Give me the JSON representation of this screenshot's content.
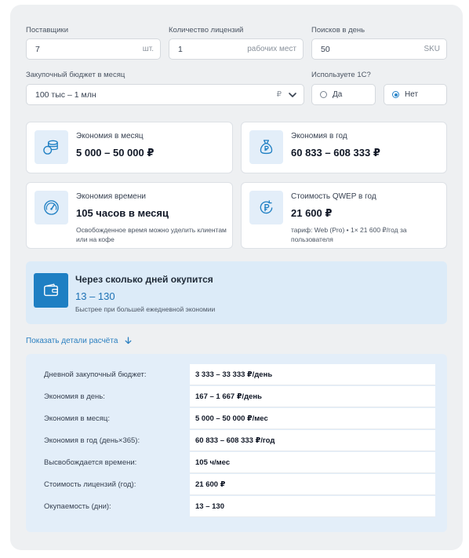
{
  "form": {
    "suppliers": {
      "label": "Поставщики",
      "value": "7",
      "unit": "шт."
    },
    "licenses": {
      "label": "Количество лицензий",
      "value": "1",
      "unit": "рабочих мест"
    },
    "searches": {
      "label": "Поисков в день",
      "value": "50",
      "unit": "SKU"
    },
    "budget": {
      "label": "Закупочный бюджет в месяц",
      "value": "100 тыс – 1 млн",
      "unit": "₽"
    },
    "uses_1c": {
      "label": "Используете 1С?",
      "options": [
        "Да",
        "Нет"
      ],
      "selected": "Нет"
    }
  },
  "cards": {
    "month": {
      "title": "Экономия в месяц",
      "value": "5 000 – 50 000 ₽",
      "icon": "coins-icon"
    },
    "year": {
      "title": "Экономия в год",
      "value": "60 833 – 608 333 ₽",
      "icon": "money-bag-icon"
    },
    "time": {
      "title": "Экономия времени",
      "value": "105 часов в месяц",
      "note": "Освобожденное время можно уделить клиентам или на кофе",
      "icon": "speedometer-icon"
    },
    "cost": {
      "title": "Стоимость QWEP в год",
      "value": "21 600 ₽",
      "note": "тариф: Web (Pro) • 1× 21 600 ₽/год за пользователя",
      "icon": "ruble-refresh-icon"
    }
  },
  "payback": {
    "title": "Через сколько дней окупится",
    "value": "13 – 130",
    "note": "Быстрее при большей ежедневной экономии",
    "icon": "wallet-icon"
  },
  "details_toggle": {
    "label": "Показать детали расчёта"
  },
  "details": [
    {
      "label": "Дневной закупочный бюджет:",
      "value": "3 333 – 33 333 ₽/день"
    },
    {
      "label": "Экономия в день:",
      "value": "167 – 1 667 ₽/день"
    },
    {
      "label": "Экономия в месяц:",
      "value": "5 000 – 50 000 ₽/мес"
    },
    {
      "label": "Экономия в год (день×365):",
      "value": "60 833 – 608 333 ₽/год"
    },
    {
      "label": "Высвобождается времени:",
      "value": "105 ч/мес"
    },
    {
      "label": "Стоимость лицензий (год):",
      "value": "21 600 ₽"
    },
    {
      "label": "Окупаемость (дни):",
      "value": "13 – 130"
    }
  ],
  "colors": {
    "accent": "#1e7fc3",
    "panel_bg": "#eef0f2",
    "highlight_bg": "#dcebf8"
  }
}
